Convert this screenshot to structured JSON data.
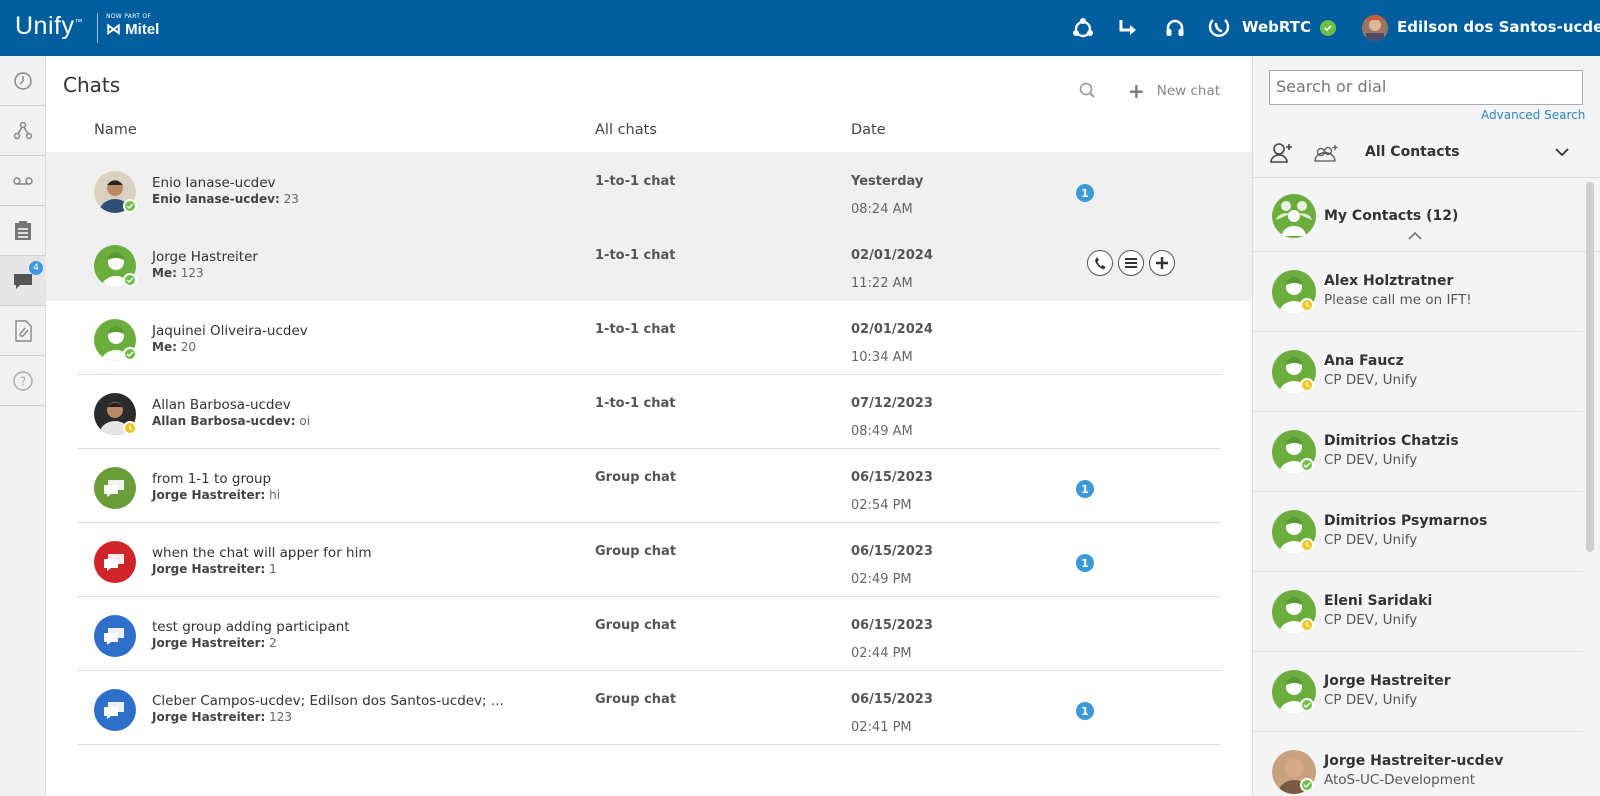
{
  "brand": {
    "name": "Unify",
    "tm": "™",
    "partner_small": "NOW PART OF",
    "partner": "Mitel",
    "partner_prefix": "⋈"
  },
  "topbar": {
    "webrtc_label": "WebRTC",
    "user_name": "Edilson dos Santos-ucdev"
  },
  "leftnav": {
    "chat_badge": "4"
  },
  "chats": {
    "title": "Chats",
    "new_chat_label": "New chat",
    "columns": {
      "name": "Name",
      "type": "All chats",
      "date": "Date"
    },
    "rows": [
      {
        "name": "Enio Ianase-ucdev",
        "last_sender": "Enio Ianase-ucdev:",
        "last_msg": " 23",
        "type": "1-to-1 chat",
        "date": "Yesterday",
        "time": "08:24 AM",
        "unread": "1",
        "avatar": "photo-man",
        "presence": "available"
      },
      {
        "name": "Jorge Hastreiter",
        "last_sender": "Me:",
        "last_msg": " 123",
        "type": "1-to-1 chat",
        "date": "02/01/2024",
        "time": "11:22 AM",
        "unread": "",
        "avatar": "default-user",
        "presence": "available"
      },
      {
        "name": "Jaquinei Oliveira-ucdev",
        "last_sender": "Me:",
        "last_msg": " 20",
        "type": "1-to-1 chat",
        "date": "02/01/2024",
        "time": "10:34 AM",
        "unread": "",
        "avatar": "default-user",
        "presence": "available"
      },
      {
        "name": "Allan Barbosa-ucdev",
        "last_sender": "Allan Barbosa-ucdev:",
        "last_msg": " oi",
        "type": "1-to-1 chat",
        "date": "07/12/2023",
        "time": "08:49 AM",
        "unread": "",
        "avatar": "photo-man-dark",
        "presence": "away"
      },
      {
        "name": "from 1-1 to group",
        "last_sender": "Jorge Hastreiter:",
        "last_msg": " hi",
        "type": "Group chat",
        "date": "06/15/2023",
        "time": "02:54 PM",
        "unread": "1",
        "avatar": "group-green",
        "presence": ""
      },
      {
        "name": "when the chat will apper for him",
        "last_sender": "Jorge Hastreiter:",
        "last_msg": " 1",
        "type": "Group chat",
        "date": "06/15/2023",
        "time": "02:49 PM",
        "unread": "1",
        "avatar": "group-red",
        "presence": ""
      },
      {
        "name": "test group adding participant",
        "last_sender": "Jorge Hastreiter:",
        "last_msg": " 2",
        "type": "Group chat",
        "date": "06/15/2023",
        "time": "02:44 PM",
        "unread": "",
        "avatar": "group-blue",
        "presence": ""
      },
      {
        "name": "Cleber Campos-ucdev; Edilson dos Santos-ucdev; ...",
        "last_sender": "Jorge Hastreiter:",
        "last_msg": " 123",
        "type": "Group chat",
        "date": "06/15/2023",
        "time": "02:41 PM",
        "unread": "1",
        "avatar": "group-blue",
        "presence": ""
      }
    ]
  },
  "contacts_panel": {
    "search_placeholder": "Search or dial",
    "advanced_search": "Advanced Search",
    "filter": "All Contacts",
    "group_label": "My Contacts (12)",
    "contacts": [
      {
        "name": "Alex Holztratner",
        "sub": "Please call me on IFT!",
        "presence": "away"
      },
      {
        "name": "Ana Faucz",
        "sub": "CP DEV, Unify",
        "presence": "away"
      },
      {
        "name": "Dimitrios Chatzis",
        "sub": "CP DEV, Unify",
        "presence": "available"
      },
      {
        "name": "Dimitrios Psymarnos",
        "sub": "CP DEV, Unify",
        "presence": "away"
      },
      {
        "name": "Eleni Saridaki",
        "sub": "CP DEV, Unify",
        "presence": "away"
      },
      {
        "name": "Jorge Hastreiter",
        "sub": "CP DEV, Unify",
        "presence": "available"
      },
      {
        "name": "Jorge Hastreiter-ucdev",
        "sub": "AtoS-UC-Development",
        "presence": "available"
      }
    ]
  },
  "colors": {
    "header_bg": "#005e9f",
    "accent": "#3d9ad8",
    "available": "#6dc045",
    "away": "#f5c518",
    "group_green": "#6a9c3a",
    "group_red": "#d0232a",
    "group_blue": "#2e6fc9"
  }
}
